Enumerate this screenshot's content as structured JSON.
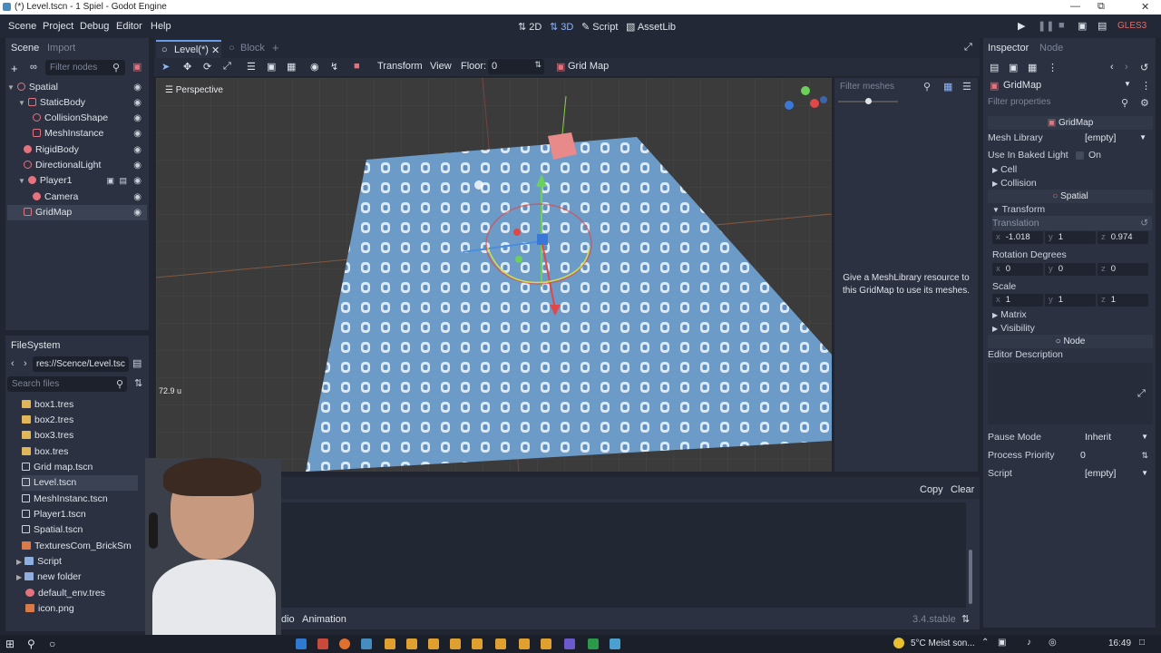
{
  "window_title": "(*) Level.tscn - 1 Spiel - Godot Engine",
  "menu": [
    "Scene",
    "Project",
    "Debug",
    "Editor",
    "Help"
  ],
  "workspaces": {
    "w2d": "2D",
    "w3d": "3D",
    "script": "Script",
    "assetlib": "AssetLib"
  },
  "renderer": "GLES3",
  "scene_dock": {
    "tab_scene": "Scene",
    "tab_import": "Import",
    "filter_placeholder": "Filter nodes",
    "nodes": [
      {
        "label": "Spatial"
      },
      {
        "label": "StaticBody"
      },
      {
        "label": "CollisionShape"
      },
      {
        "label": "MeshInstance"
      },
      {
        "label": "RigidBody"
      },
      {
        "label": "DirectionalLight"
      },
      {
        "label": "Player1"
      },
      {
        "label": "Camera"
      },
      {
        "label": "GridMap"
      }
    ]
  },
  "filesystem": {
    "title": "FileSystem",
    "path": "res://Scence/Level.tsc",
    "search_placeholder": "Search files",
    "files": [
      "box1.tres",
      "box2.tres",
      "box3.tres",
      "box.tres",
      "Grid map.tscn",
      "Level.tscn",
      "MeshInstanc.tscn",
      "Player1.tscn",
      "Spatial.tscn",
      "TexturesCom_BrickSm",
      "Script",
      "new folder",
      "default_env.tres",
      "icon.png"
    ]
  },
  "editor_tabs": {
    "level": "Level(*)",
    "block": "Block"
  },
  "toolbar": {
    "transform": "Transform",
    "view": "View",
    "floor_label": "Floor:",
    "floor_value": "0",
    "gridmap": "Grid Map"
  },
  "viewport": {
    "perspective": "Perspective",
    "zoom": "72.9 u"
  },
  "gridmap_panel": {
    "filter_placeholder": "Filter meshes",
    "message": "Give a MeshLibrary resource to this GridMap to use its meshes."
  },
  "bottom_panel": {
    "copy": "Copy",
    "clear": "Clear",
    "tab_audio": "dio",
    "tab_animation": "Animation",
    "version": "3.4.stable"
  },
  "inspector": {
    "tab_inspector": "Inspector",
    "tab_node": "Node",
    "object": "GridMap",
    "filter_placeholder": "Filter properties",
    "section_gridmap": "GridMap",
    "mesh_library_label": "Mesh Library",
    "mesh_library_value": "[empty]",
    "baked_light_label": "Use In Baked Light",
    "baked_light_value": "On",
    "cell": "Cell",
    "collision": "Collision",
    "section_spatial": "Spatial",
    "transform": "Transform",
    "translation": "Translation",
    "tx": "-1.018",
    "ty": "1",
    "tz": "0.974",
    "rotation": "Rotation Degrees",
    "rx": "0",
    "ry": "0",
    "rz": "0",
    "scale": "Scale",
    "sx": "1",
    "sy": "1",
    "sz": "1",
    "matrix": "Matrix",
    "visibility": "Visibility",
    "section_node": "Node",
    "editor_description": "Editor Description",
    "pause_mode_label": "Pause Mode",
    "pause_mode_value": "Inherit",
    "process_priority_label": "Process Priority",
    "process_priority_value": "0",
    "script_label": "Script",
    "script_value": "[empty]"
  },
  "taskbar": {
    "weather": "5°C  Meist son...",
    "time": "16:49"
  }
}
